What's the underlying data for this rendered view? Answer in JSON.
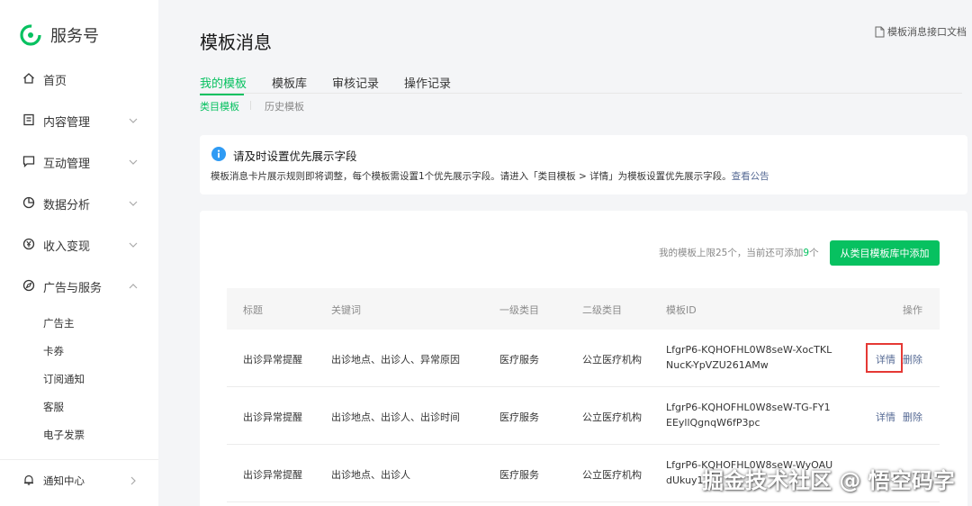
{
  "brand": {
    "name": "服务号",
    "color": "#07c160"
  },
  "nav": {
    "items": [
      {
        "label": "首页",
        "icon": "home-icon"
      },
      {
        "label": "内容管理",
        "icon": "document-icon"
      },
      {
        "label": "互动管理",
        "icon": "chat-icon"
      },
      {
        "label": "数据分析",
        "icon": "pie-chart-icon"
      },
      {
        "label": "收入变现",
        "icon": "yen-icon"
      },
      {
        "label": "广告与服务",
        "icon": "compass-icon"
      }
    ],
    "sub_items": [
      "广告主",
      "卡券",
      "订阅通知",
      "客服",
      "电子发票"
    ],
    "bottom_item": {
      "label": "通知中心",
      "icon": "bell-icon"
    }
  },
  "page": {
    "title": "模板消息",
    "doc_link": "模板消息接口文档"
  },
  "tabs": [
    "我的模板",
    "模板库",
    "审核记录",
    "操作记录"
  ],
  "subtabs": [
    "类目模板",
    "历史模板"
  ],
  "notice": {
    "title": "请及时设置优先展示字段",
    "body": "模板消息卡片展示规则即将调整，每个模板需设置1个优先展示字段。请进入「类目模板 > 详情」为模板设置优先展示字段。",
    "link": "查看公告"
  },
  "limit": {
    "prefix": "我的模板上限25个，当前还可添加",
    "count": "9",
    "suffix": "个"
  },
  "add_button": "从类目模板库中添加",
  "table": {
    "headers": [
      "标题",
      "关键词",
      "一级类目",
      "二级类目",
      "模板ID",
      "操作"
    ],
    "rows": [
      {
        "title": "出诊异常提醒",
        "keywords": "出诊地点、出诊人、异常原因",
        "cat1": "医疗服务",
        "cat2": "公立医疗机构",
        "id": "LfgrP6-KQHOFHL0W8seW-XocTKLNucK-YpVZU261AMw",
        "detail": "详情",
        "delete": "删除"
      },
      {
        "title": "出诊异常提醒",
        "keywords": "出诊地点、出诊人、出诊时间",
        "cat1": "医疗服务",
        "cat2": "公立医疗机构",
        "id": "LfgrP6-KQHOFHL0W8seW-TG-FY1EEyllQgnqW6fP3pc",
        "detail": "详情",
        "delete": "删除"
      },
      {
        "title": "出诊异常提醒",
        "keywords": "出诊地点、出诊人",
        "cat1": "医疗服务",
        "cat2": "公立医疗机构",
        "id": "LfgrP6-KQHOFHL0W8seW-WyOAUdUkuy1",
        "detail": "",
        "delete": ""
      }
    ]
  },
  "watermark": "掘金技术社区 @ 悟空码字"
}
